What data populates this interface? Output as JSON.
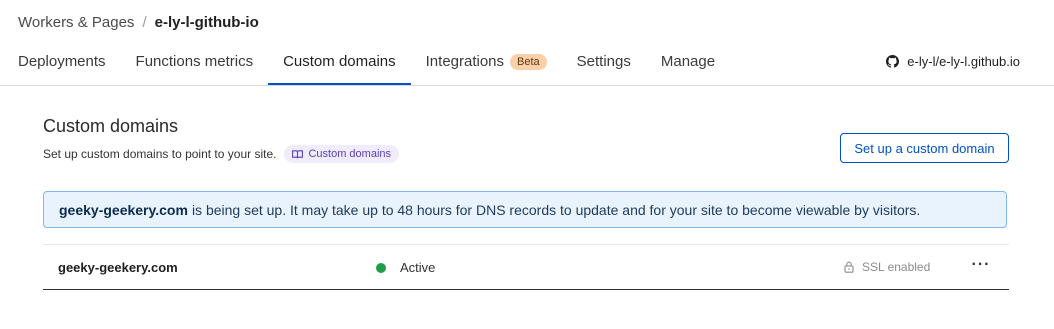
{
  "breadcrumb": {
    "parent": "Workers & Pages",
    "separator": "/",
    "current": "e-ly-l-github-io"
  },
  "tabs": [
    {
      "label": "Deployments",
      "active": false
    },
    {
      "label": "Functions metrics",
      "active": false
    },
    {
      "label": "Custom domains",
      "active": true
    },
    {
      "label": "Integrations",
      "active": false,
      "badge": "Beta"
    },
    {
      "label": "Settings",
      "active": false
    },
    {
      "label": "Manage",
      "active": false
    }
  ],
  "repo": {
    "icon": "github-icon",
    "label": "e-ly-l/e-ly-l.github.io"
  },
  "section": {
    "title": "Custom domains",
    "description": "Set up custom domains to point to your site.",
    "doc_chip_icon": "book-icon",
    "doc_chip_label": "Custom domains",
    "setup_button": "Set up a custom domain"
  },
  "banner": {
    "domain": "geeky-geekery.com",
    "message": "is being set up. It may take up to 48 hours for DNS records to update and for your site to become viewable by visitors."
  },
  "domains": [
    {
      "name": "geeky-geekery.com",
      "status": "Active",
      "status_color": "#1e9e4a",
      "ssl_icon": "lock-icon",
      "ssl": "SSL enabled",
      "more_icon": "more-horizontal-icon"
    }
  ],
  "colors": {
    "accent": "#0051c3",
    "banner_bg": "#e9f3fd",
    "banner_border": "#82b7ea",
    "beta_badge": "#fbcfa7"
  }
}
